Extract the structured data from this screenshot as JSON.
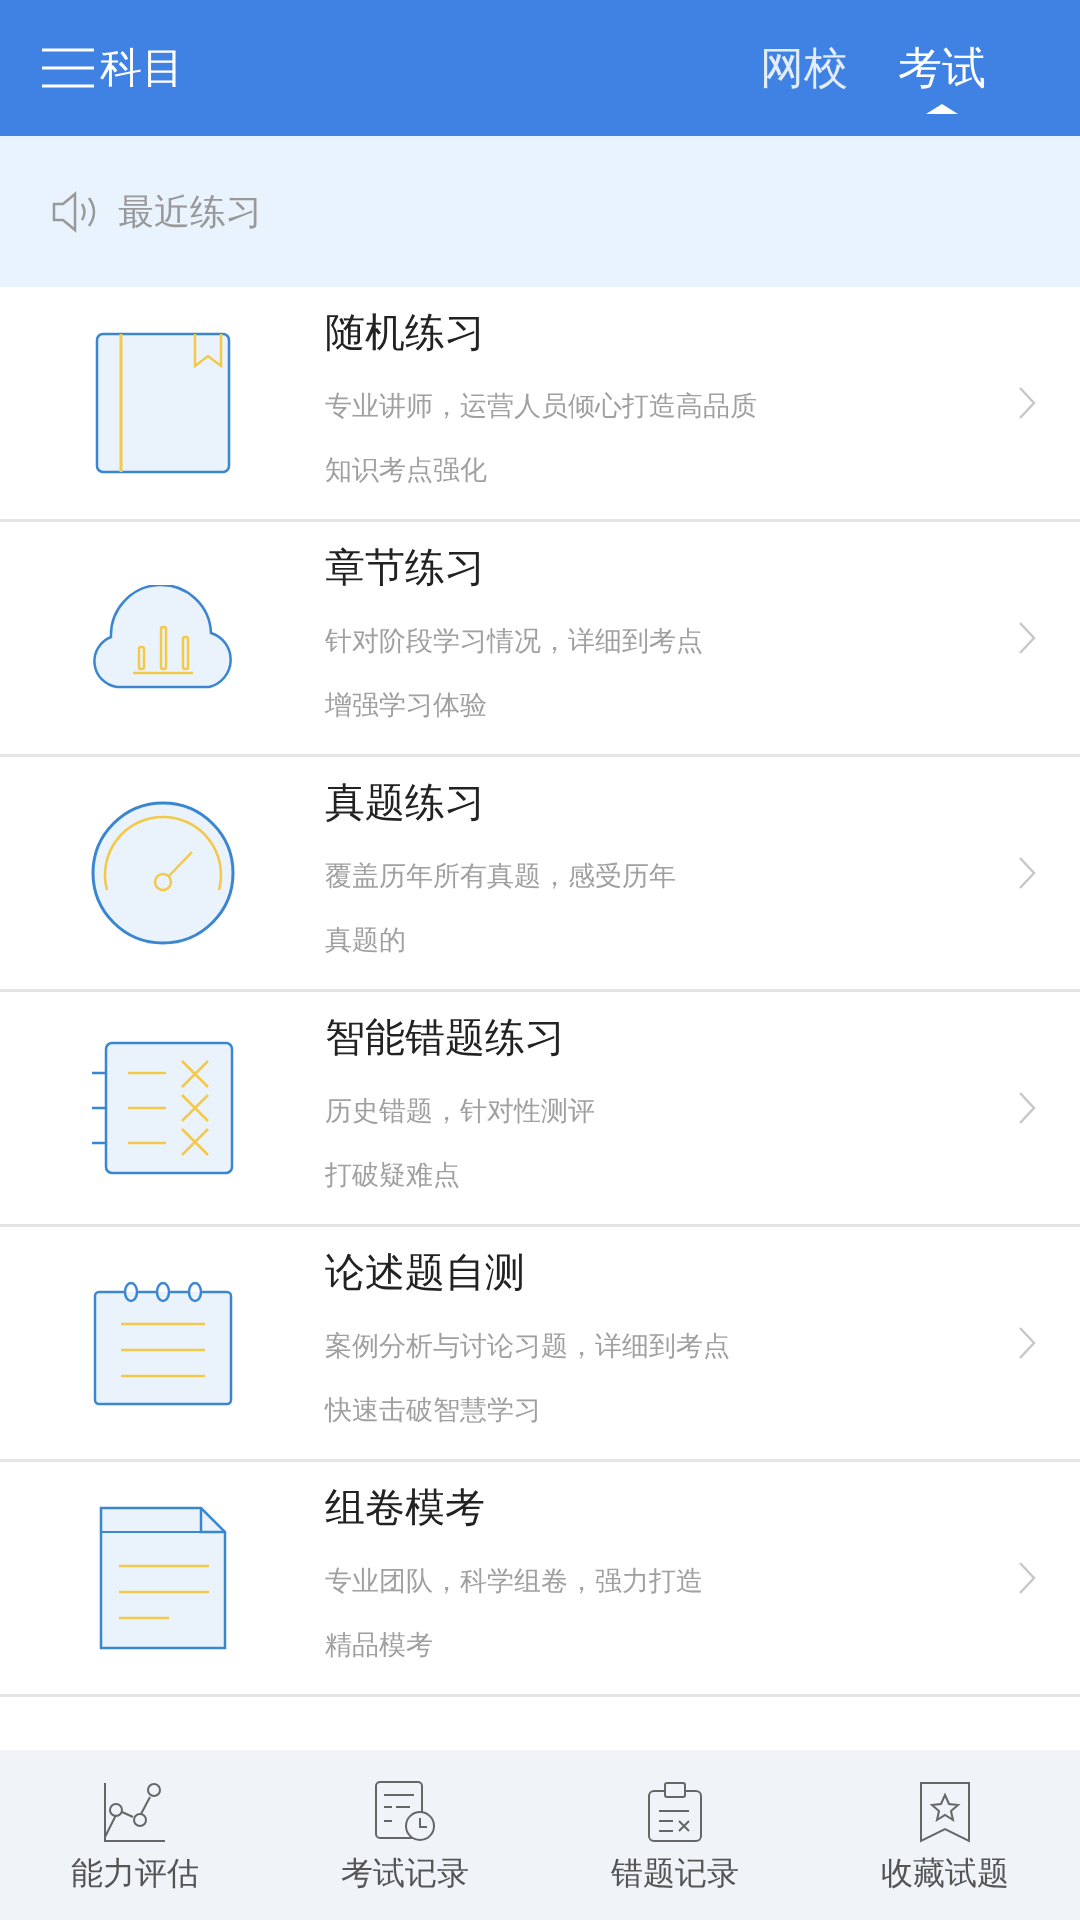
{
  "header": {
    "title": "科目",
    "tabs": [
      {
        "label": "网校",
        "selected": false
      },
      {
        "label": "考试",
        "selected": true
      }
    ]
  },
  "recent": {
    "label": "最近练习"
  },
  "items": [
    {
      "kind": "book",
      "title": "随机练习",
      "lines": [
        "专业讲师，运营人员倾心打造高品质",
        "知识考点强化"
      ]
    },
    {
      "kind": "cloud",
      "title": "章节练习",
      "lines": [
        "针对阶段学习情况，详细到考点",
        "增强学习体验"
      ]
    },
    {
      "kind": "gauge",
      "title": "真题练习",
      "lines": [
        "覆盖历年所有真题，感受历年",
        "真题的"
      ]
    },
    {
      "kind": "notebook",
      "title": "智能错题练习",
      "lines": [
        "历史错题，针对性测评",
        "打破疑难点"
      ]
    },
    {
      "kind": "calendar",
      "title": "论述题自测",
      "lines": [
        "案例分析与讨论习题，详细到考点",
        "快速击破智慧学习"
      ]
    },
    {
      "kind": "document",
      "title": "组卷模考",
      "lines": [
        "专业团队，科学组卷，强力打造",
        "精品模考"
      ]
    }
  ],
  "bottom_nav": [
    {
      "kind": "chart",
      "label": "能力评估"
    },
    {
      "kind": "record",
      "label": "考试记录"
    },
    {
      "kind": "clipboard",
      "label": "错题记录"
    },
    {
      "kind": "bookmark",
      "label": "收藏试题"
    }
  ]
}
